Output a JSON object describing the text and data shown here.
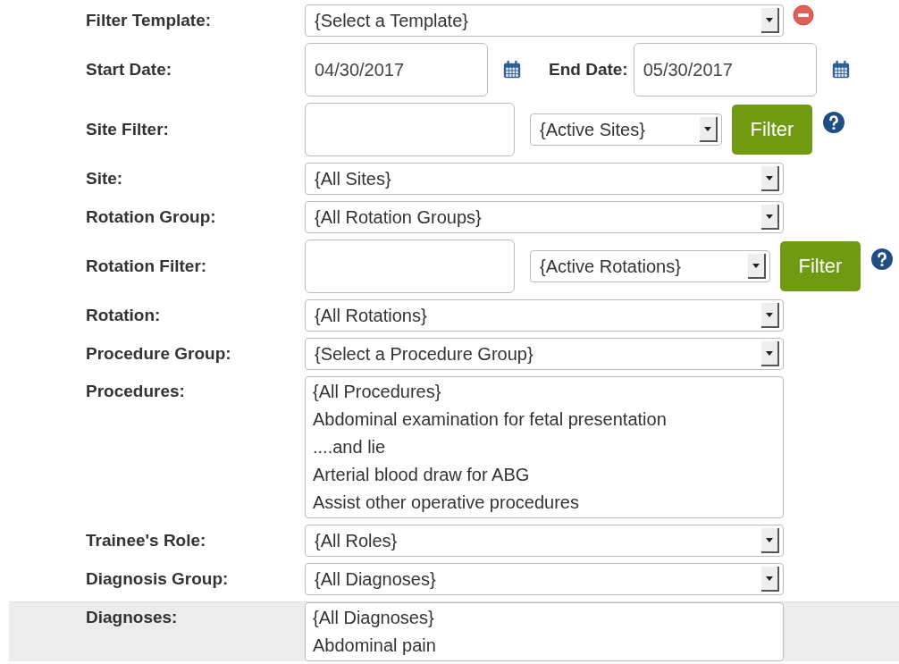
{
  "filter_form": {
    "rows": [
      {
        "kind": "select",
        "label": "Filter Template:",
        "value": "{Select a Template}",
        "removable": true,
        "highlighted": false
      },
      {
        "kind": "dates",
        "label": "Start Date:",
        "value": "04/30/2017",
        "end_label": "End Date:",
        "end_value": "05/30/2017",
        "highlighted": false
      },
      {
        "kind": "filter",
        "label": "Site Filter:",
        "option": "{Active Sites}",
        "button": "Filter",
        "highlighted": false
      },
      {
        "kind": "select",
        "label": "Site:",
        "value": "{All Sites}",
        "removable": false,
        "highlighted": false
      },
      {
        "kind": "select",
        "label": "Rotation Group:",
        "value": "{All Rotation Groups}",
        "removable": false,
        "highlighted": false
      },
      {
        "kind": "filter",
        "label": "Rotation Filter:",
        "option": "{Active Rotations}",
        "button": "Filter",
        "highlighted": false
      },
      {
        "kind": "select",
        "label": "Rotation:",
        "value": "{All Rotations}",
        "removable": false,
        "highlighted": false
      },
      {
        "kind": "select",
        "label": "Procedure Group:",
        "value": "{Select a Procedure Group}",
        "removable": false,
        "highlighted": false
      },
      {
        "kind": "list",
        "label": "Procedures:",
        "options": [
          "{All Procedures}",
          "Abdominal examination for fetal presentation",
          "....and lie",
          "Arterial blood draw for ABG",
          "Assist other operative procedures"
        ],
        "highlighted": false
      },
      {
        "kind": "select",
        "label": "Trainee's Role:",
        "value": "{All Roles}",
        "removable": false,
        "highlighted": false
      },
      {
        "kind": "select",
        "label": "Diagnosis Group:",
        "value": "{All Diagnoses}",
        "removable": false,
        "highlighted": false
      },
      {
        "kind": "list",
        "label": "Diagnoses:",
        "options": [
          "{All Diagnoses}",
          "Abdominal pain"
        ],
        "highlighted": true
      }
    ]
  }
}
